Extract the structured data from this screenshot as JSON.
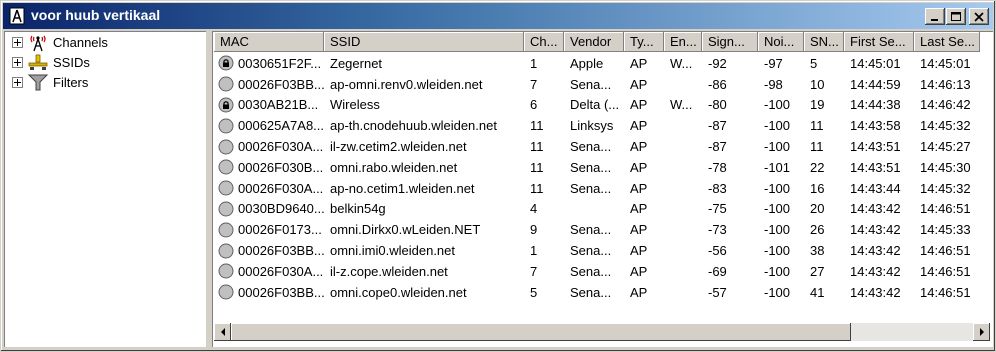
{
  "window": {
    "title": "voor huub vertikaal"
  },
  "tree": {
    "items": [
      {
        "label": "Channels",
        "icon": "antenna-icon"
      },
      {
        "label": "SSIDs",
        "icon": "network-icon"
      },
      {
        "label": "Filters",
        "icon": "funnel-icon"
      }
    ]
  },
  "table": {
    "columns": [
      "MAC",
      "SSID",
      "Ch...",
      "Vendor",
      "Ty...",
      "En...",
      "Sign...",
      "Noi...",
      "SN...",
      "First Se...",
      "Last Se..."
    ],
    "rows": [
      {
        "locked": true,
        "cells": [
          "0030651F2F...",
          "Zegernet",
          "1",
          "Apple",
          "AP",
          "W...",
          "-92",
          "-97",
          "5",
          "14:45:01",
          "14:45:01"
        ]
      },
      {
        "locked": false,
        "cells": [
          "00026F03BB...",
          "ap-omni.renv0.wleiden.net",
          "7",
          "Sena...",
          "AP",
          "",
          "-86",
          "-98",
          "10",
          "14:44:59",
          "14:46:13"
        ]
      },
      {
        "locked": true,
        "cells": [
          "0030AB21B...",
          "Wireless",
          "6",
          "Delta (...",
          "AP",
          "W...",
          "-80",
          "-100",
          "19",
          "14:44:38",
          "14:46:42"
        ]
      },
      {
        "locked": false,
        "cells": [
          "000625A7A8...",
          "ap-th.cnodehuub.wleiden.net",
          "11",
          "Linksys",
          "AP",
          "",
          "-87",
          "-100",
          "11",
          "14:43:58",
          "14:45:32"
        ]
      },
      {
        "locked": false,
        "cells": [
          "00026F030A...",
          "il-zw.cetim2.wleiden.net",
          "11",
          "Sena...",
          "AP",
          "",
          "-87",
          "-100",
          "11",
          "14:43:51",
          "14:45:27"
        ]
      },
      {
        "locked": false,
        "cells": [
          "00026F030B...",
          "omni.rabo.wleiden.net",
          "11",
          "Sena...",
          "AP",
          "",
          "-78",
          "-101",
          "22",
          "14:43:51",
          "14:45:30"
        ]
      },
      {
        "locked": false,
        "cells": [
          "00026F030A...",
          "ap-no.cetim1.wleiden.net",
          "11",
          "Sena...",
          "AP",
          "",
          "-83",
          "-100",
          "16",
          "14:43:44",
          "14:45:32"
        ]
      },
      {
        "locked": false,
        "cells": [
          "0030BD9640...",
          "belkin54g",
          "4",
          "",
          "AP",
          "",
          "-75",
          "-100",
          "20",
          "14:43:42",
          "14:46:51"
        ]
      },
      {
        "locked": false,
        "cells": [
          "00026F0173...",
          "omni.Dirkx0.wLeiden.NET",
          "9",
          "Sena...",
          "AP",
          "",
          "-73",
          "-100",
          "26",
          "14:43:42",
          "14:45:33"
        ]
      },
      {
        "locked": false,
        "cells": [
          "00026F03BB...",
          "omni.imi0.wleiden.net",
          "1",
          "Sena...",
          "AP",
          "",
          "-56",
          "-100",
          "38",
          "14:43:42",
          "14:46:51"
        ]
      },
      {
        "locked": false,
        "cells": [
          "00026F030A...",
          "il-z.cope.wleiden.net",
          "7",
          "Sena...",
          "AP",
          "",
          "-69",
          "-100",
          "27",
          "14:43:42",
          "14:46:51"
        ]
      },
      {
        "locked": false,
        "cells": [
          "00026F03BB...",
          "omni.cope0.wleiden.net",
          "5",
          "Sena...",
          "AP",
          "",
          "-57",
          "-100",
          "41",
          "14:43:42",
          "14:46:51"
        ]
      }
    ]
  }
}
